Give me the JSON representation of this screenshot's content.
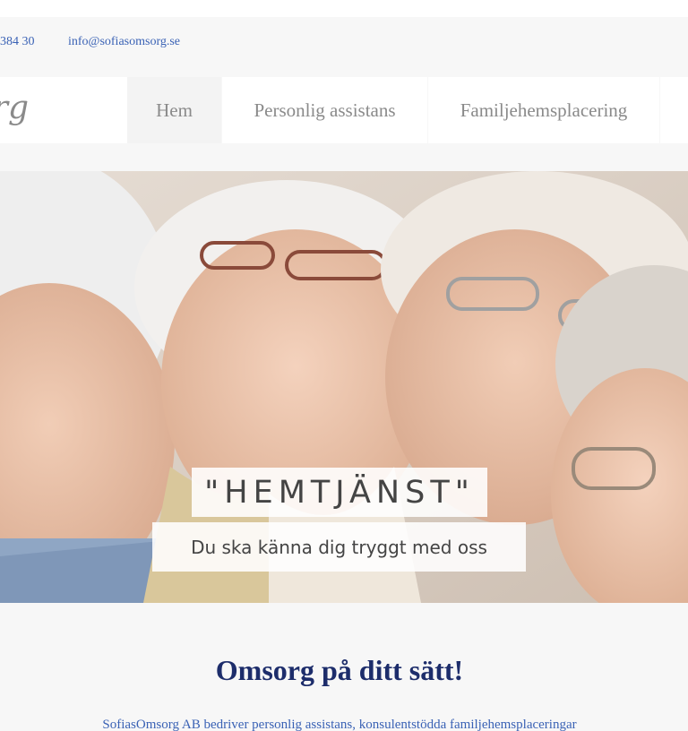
{
  "contact": {
    "phone": " 384 30",
    "email": "info@sofiasomsorg.se"
  },
  "logo": {
    "text": "org"
  },
  "nav": {
    "items": [
      {
        "label": "Hem",
        "active": true
      },
      {
        "label": "Personlig assistans",
        "active": false
      },
      {
        "label": "Familjehemsplacering",
        "active": false
      }
    ]
  },
  "hero": {
    "title": "\"HEMTJÄNST\"",
    "subtitle": "Du ska känna dig tryggt med oss"
  },
  "intro": {
    "heading": "Omsorg på ditt sätt!",
    "body": "SofiasOmsorg AB bedriver personlig assistans, konsulentstödda familjehemsplaceringar"
  },
  "colors": {
    "link": "#3a62b5",
    "heading": "#1d2d6b",
    "nav_text": "#8a8a8a",
    "bar_bg": "#f7f7f7"
  }
}
